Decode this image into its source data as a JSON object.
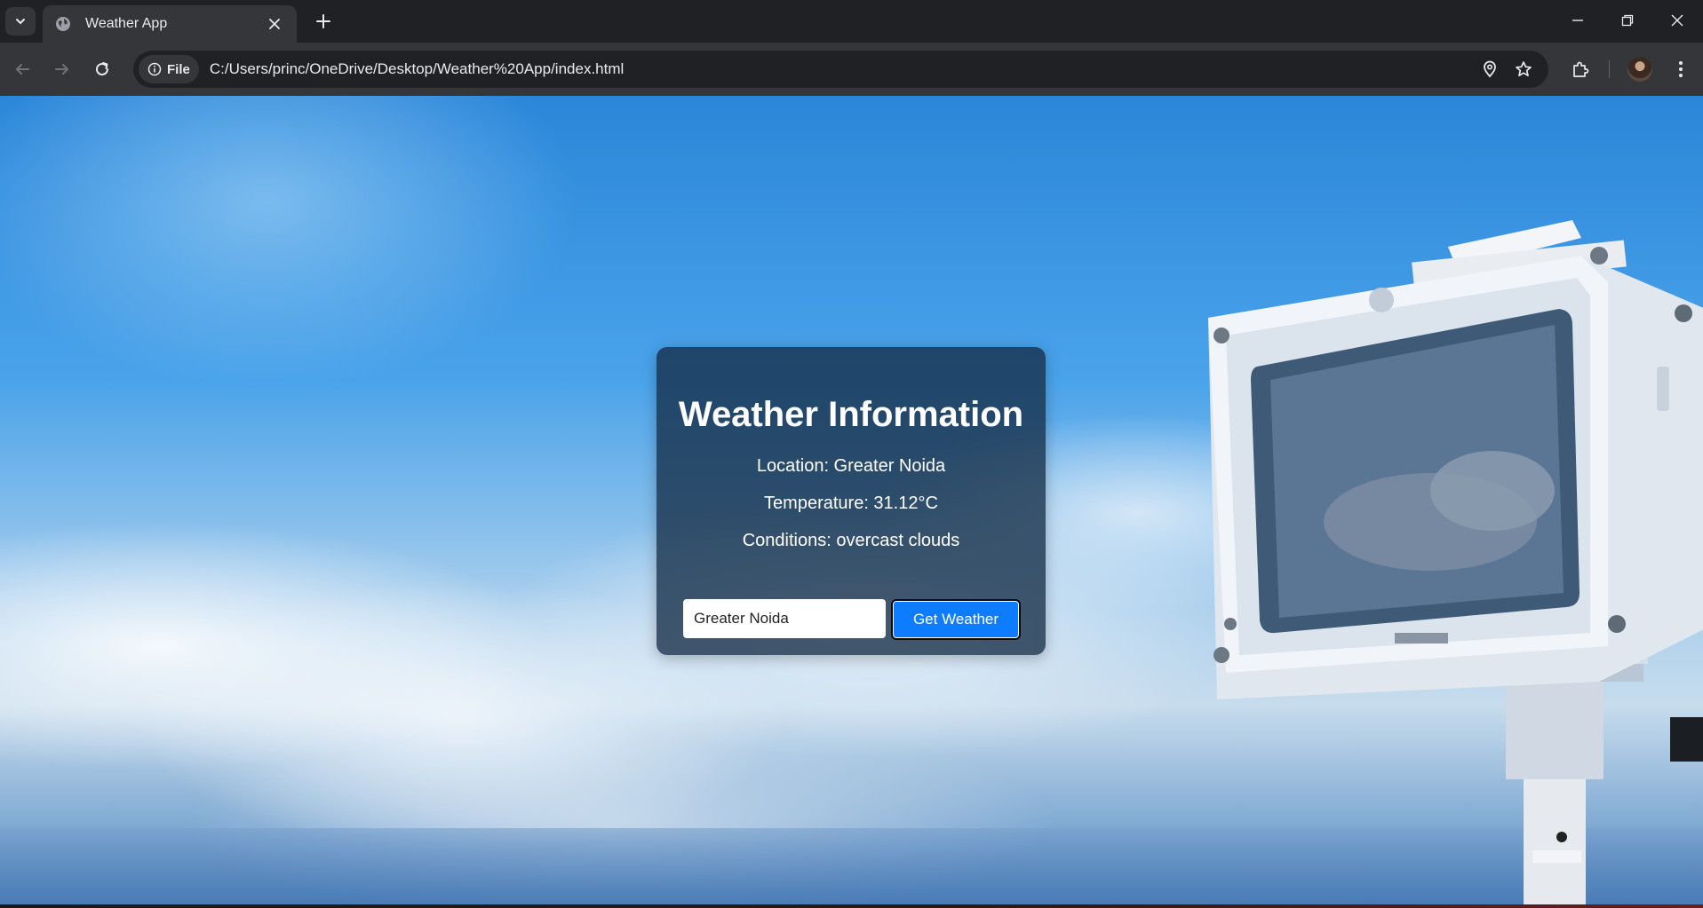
{
  "browser": {
    "tab": {
      "title": "Weather App",
      "favicon": "globe-icon"
    },
    "omnibox": {
      "chip_label": "File",
      "url": "C:/Users/princ/OneDrive/Desktop/Weather%20App/index.html"
    },
    "icons": [
      "tab-search-icon",
      "close-icon",
      "plus-icon",
      "minimize-icon",
      "restore-icon",
      "close-window-icon",
      "back-arrow-icon",
      "forward-arrow-icon",
      "reload-icon",
      "info-icon",
      "location-pin-icon",
      "star-icon",
      "extensions-icon",
      "avatar",
      "more-vert-icon"
    ]
  },
  "weather": {
    "title": "Weather Information",
    "location": "Location: Greater Noida",
    "temperature": "Temperature: 31.12°C",
    "conditions": "Conditions: overcast clouds",
    "input_value": "Greater Noida",
    "button_label": "Get Weather"
  },
  "colors": {
    "button_bg": "#0d7cff",
    "card_bg": "#142d46",
    "browser_dark": "#202124",
    "browser_toolbar": "#35363a"
  }
}
